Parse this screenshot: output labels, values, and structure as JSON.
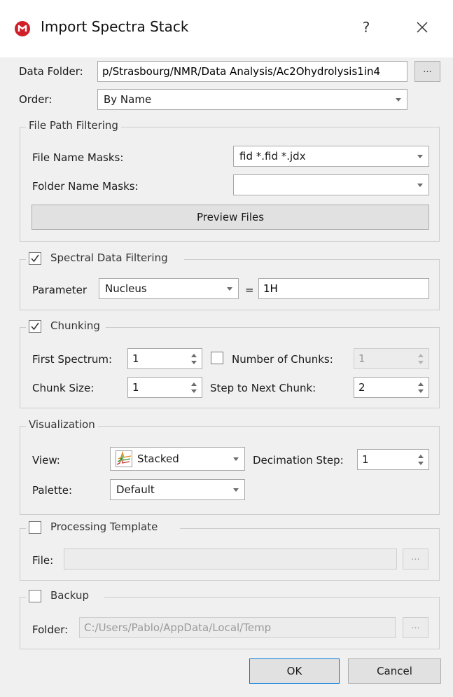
{
  "window": {
    "title": "Import Spectra Stack",
    "help_label": "?"
  },
  "data_folder": {
    "label": "Data Folder:",
    "value": "p/Strasbourg/NMR/Data Analysis/Ac2Ohydrolysis1in4",
    "browse_label": "..."
  },
  "order": {
    "label": "Order:",
    "value": "By Name"
  },
  "file_path_filtering": {
    "title": "File Path Filtering",
    "file_name_masks_label": "File Name Masks:",
    "file_name_masks_value": "fid *.fid *.jdx",
    "folder_name_masks_label": "Folder Name Masks:",
    "folder_name_masks_value": "",
    "preview_label": "Preview Files"
  },
  "spectral_data_filtering": {
    "title": "Spectral Data Filtering",
    "checked": true,
    "parameter_label": "Parameter",
    "parameter_value": "Nucleus",
    "equals": "=",
    "value": "1H"
  },
  "chunking": {
    "title": "Chunking",
    "checked": true,
    "first_spectrum_label": "First Spectrum:",
    "first_spectrum_value": "1",
    "number_of_chunks_label": "Number of Chunks:",
    "number_of_chunks_checked": false,
    "number_of_chunks_value": "1",
    "chunk_size_label": "Chunk Size:",
    "chunk_size_value": "1",
    "step_label": "Step to Next Chunk:",
    "step_value": "2"
  },
  "visualization": {
    "title": "Visualization",
    "view_label": "View:",
    "view_value": "Stacked",
    "decimation_label": "Decimation Step:",
    "decimation_value": "1",
    "palette_label": "Palette:",
    "palette_value": "Default"
  },
  "processing_template": {
    "title": "Processing Template",
    "checked": false,
    "file_label": "File:",
    "file_value": "",
    "browse_label": "..."
  },
  "backup": {
    "title": "Backup",
    "checked": false,
    "folder_label": "Folder:",
    "folder_value": "C:/Users/Pablo/AppData/Local/Temp",
    "browse_label": "..."
  },
  "buttons": {
    "ok_label": "OK",
    "cancel_label": "Cancel"
  },
  "colors": {
    "app_icon": "#d11f2a",
    "ok_focus_border": "#0078d7"
  },
  "icons": {
    "app": "mestrenova-logo-icon",
    "close": "close-icon",
    "view": "stacked-plot-icon"
  }
}
